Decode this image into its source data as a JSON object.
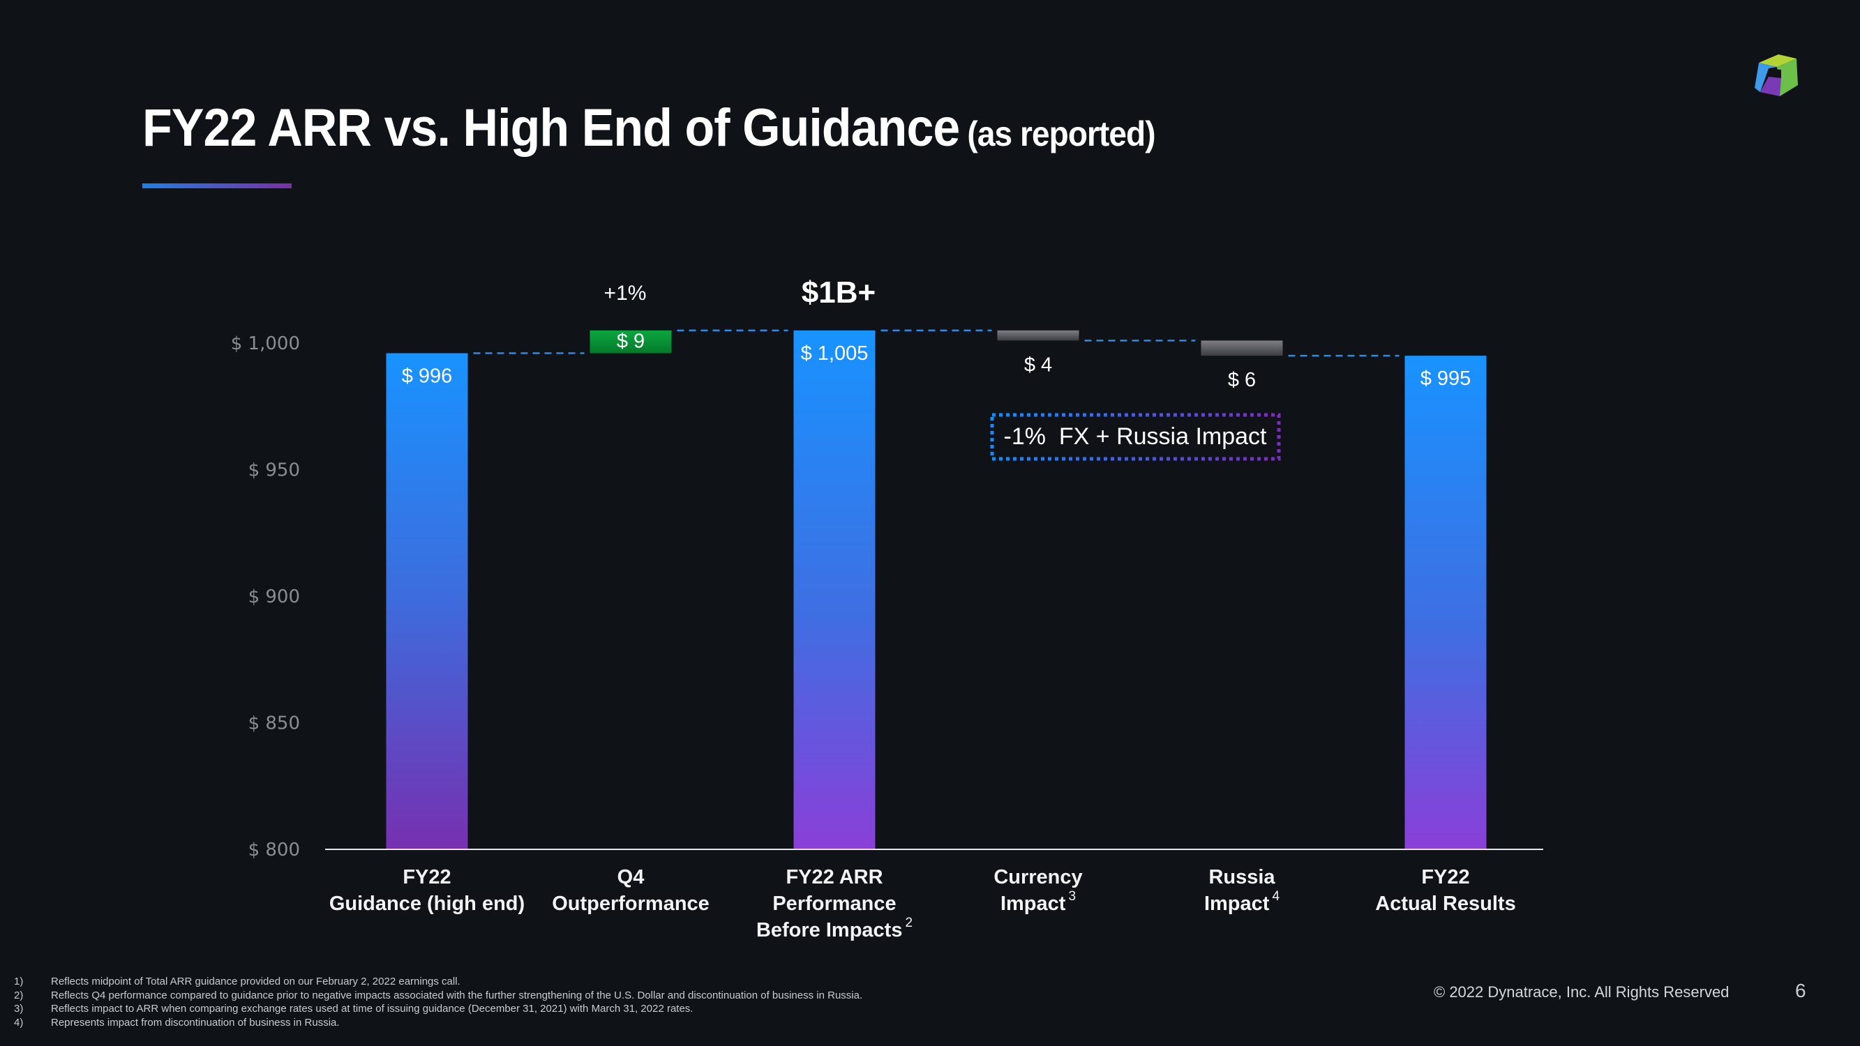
{
  "slide": {
    "title": "FY22 ARR vs. High End of Guidance",
    "title_suffix": "(as reported)",
    "logo": "dynatrace-cube-logo",
    "copyright": "© 2022 Dynatrace, Inc. All Rights Reserved",
    "page_number": "6",
    "colors": {
      "background": "#0f1318",
      "total_bar_top": "#1a92ff",
      "total_bar_bottom": "#7a32b8",
      "increase_bar": "#0b9b3c",
      "decrease_bar": "#6e7075",
      "connector": "#2c8ae8",
      "accent_blue": "#1f7fe6",
      "accent_purple": "#7a2fa6"
    }
  },
  "callout": {
    "text": "-1%  FX + Russia Impact"
  },
  "footnotes": [
    {
      "num": "1)",
      "text": "Reflects midpoint of Total ARR guidance provided on our February 2, 2022 earnings call."
    },
    {
      "num": "2)",
      "text": "Reflects Q4 performance compared to guidance prior to negative impacts associated with the further strengthening of the U.S. Dollar and discontinuation of business in Russia."
    },
    {
      "num": "3)",
      "text": "Reflects impact to ARR when comparing exchange rates used at time of issuing guidance (December 31, 2021) with March 31, 2022 rates."
    },
    {
      "num": "4)",
      "text": "Represents impact from discontinuation of business in Russia."
    }
  ],
  "chart_data": {
    "type": "bar",
    "subtype": "waterfall",
    "title": "FY22 ARR vs. High End of Guidance (as reported)",
    "units": "$M",
    "xlabel": "",
    "ylabel": "",
    "ylim": [
      800,
      1000
    ],
    "yticks": [
      800,
      850,
      900,
      950,
      1000
    ],
    "ytick_labels": [
      "$ 800",
      "$ 850",
      "$ 900",
      "$ 950",
      "$ 1,000"
    ],
    "grid": false,
    "categories": [
      {
        "lines": [
          "FY22",
          "Guidance (high end)"
        ],
        "superscript": ""
      },
      {
        "lines": [
          "Q4",
          "Outperformance"
        ],
        "superscript": ""
      },
      {
        "lines": [
          "FY22 ARR",
          "Performance",
          "Before Impacts"
        ],
        "superscript": "2"
      },
      {
        "lines": [
          "Currency",
          "Impact"
        ],
        "superscript": "3"
      },
      {
        "lines": [
          "Russia",
          "Impact"
        ],
        "superscript": "4"
      },
      {
        "lines": [
          "FY22",
          "Actual Results"
        ],
        "superscript": ""
      }
    ],
    "bars": [
      {
        "kind": "total",
        "value": 996,
        "label": "$ 996"
      },
      {
        "kind": "increase",
        "value": 9,
        "start": 996,
        "end": 1005,
        "label": "$ 9"
      },
      {
        "kind": "total",
        "value": 1005,
        "label": "$ 1,005"
      },
      {
        "kind": "decrease",
        "value": -4,
        "start": 1005,
        "end": 1001,
        "label": "$ 4"
      },
      {
        "kind": "decrease",
        "value": -6,
        "start": 1001,
        "end": 995,
        "label": "$ 6"
      },
      {
        "kind": "total",
        "value": 995,
        "label": "$ 995"
      }
    ],
    "annotations": [
      {
        "category_index": 1,
        "text": "+1%"
      },
      {
        "category_index": 2,
        "text": "$1B+"
      }
    ]
  }
}
